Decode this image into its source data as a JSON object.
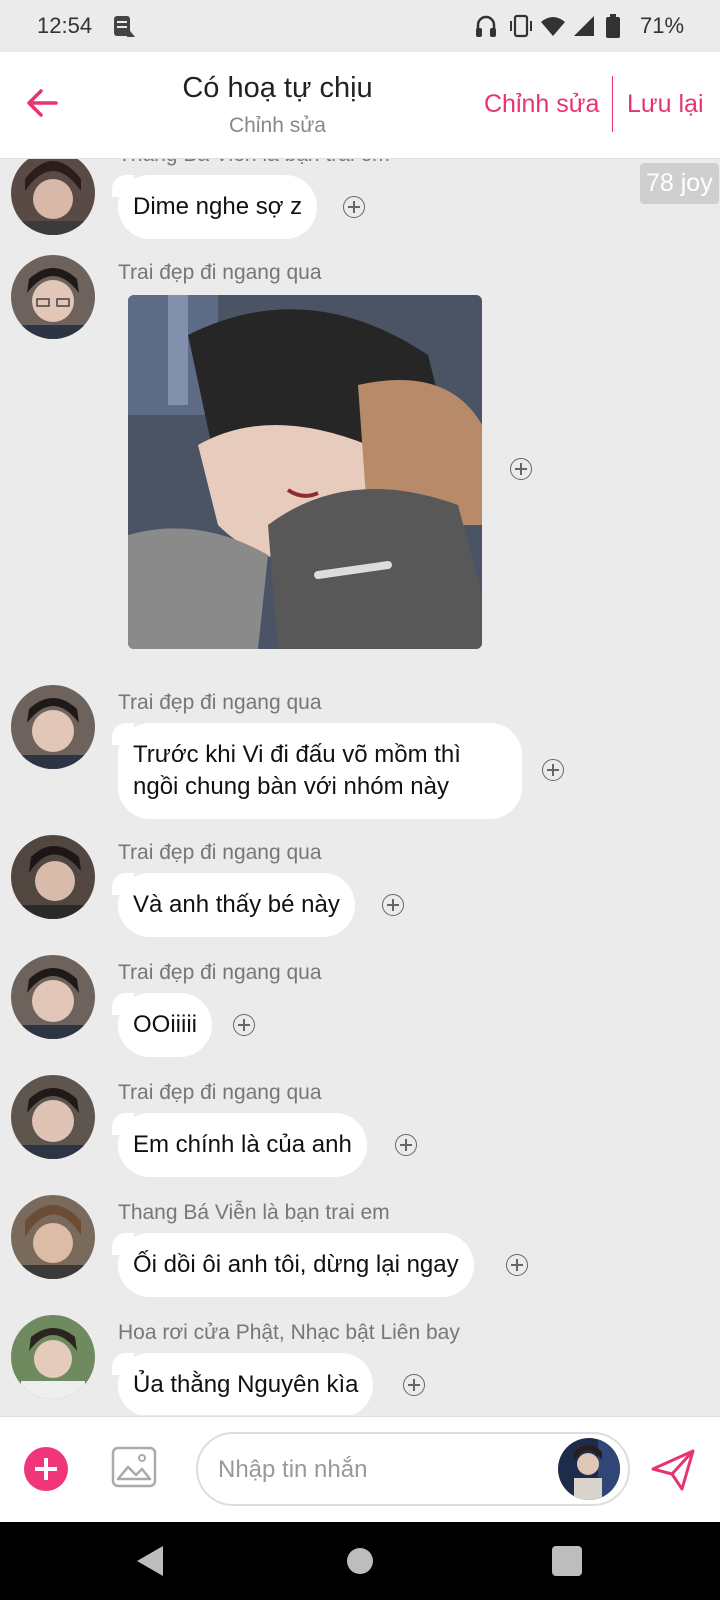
{
  "status_bar": {
    "time": "12:54",
    "battery_percent": "71%",
    "icons": [
      "debug-icon",
      "headphones-icon",
      "vibrate-icon",
      "wifi-icon",
      "signal-icon",
      "battery-icon"
    ]
  },
  "header": {
    "title": "Có hoạ tự chịu",
    "subtitle": "Chỉnh sửa",
    "edit_label": "Chỉnh sửa",
    "save_label": "Lưu lại",
    "accent_color": "#e8336d"
  },
  "chat": {
    "joy_badge": "78 joy",
    "messages": [
      {
        "sender": "Thang Bá Viễn là bạn trai em",
        "text": "Dime nghe sợ z",
        "type": "text"
      },
      {
        "sender": "Trai đẹp đi ngang qua",
        "text": "",
        "type": "image"
      },
      {
        "sender": "Trai đẹp đi ngang qua",
        "text": "Trước khi Vi đi đấu võ mồm thì ngồi chung bàn với nhóm này",
        "type": "text"
      },
      {
        "sender": "Trai đẹp đi ngang qua",
        "text": "Và anh thấy bé này",
        "type": "text"
      },
      {
        "sender": "Trai đẹp đi ngang qua",
        "text": "OOiiiii",
        "type": "text"
      },
      {
        "sender": "Trai đẹp đi ngang qua",
        "text": "Em chính là của anh",
        "type": "text"
      },
      {
        "sender": "Thang Bá Viễn là bạn trai em",
        "text": "Ối dồi ôi anh tôi, dừng lại ngay",
        "type": "text"
      },
      {
        "sender": "Hoa rơi cửa Phật, Nhạc bật Liên bay",
        "text": "Ủa thằng Nguyên kìa",
        "type": "text"
      }
    ]
  },
  "composer": {
    "placeholder": "Nhập tin nhắn",
    "add_color": "#f0357a",
    "send_color": "#e8336d"
  }
}
